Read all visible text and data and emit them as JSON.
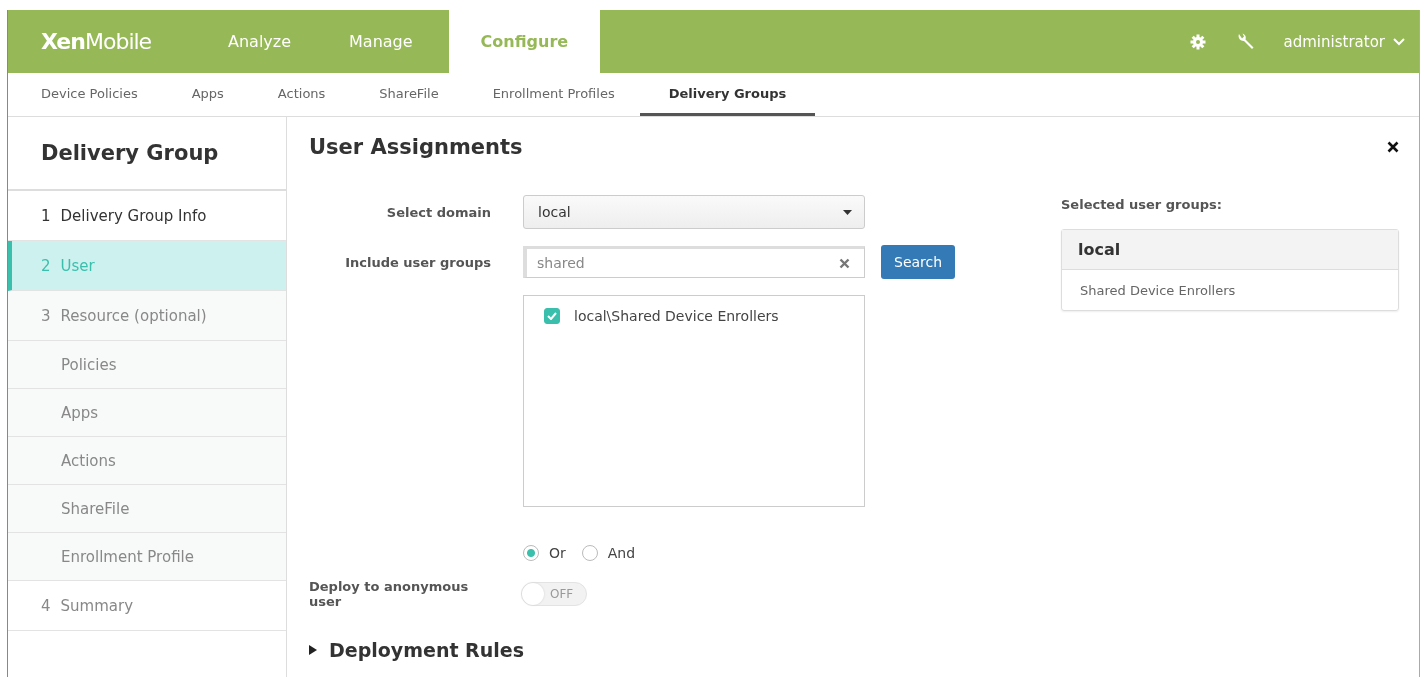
{
  "header": {
    "logo_bold": "Xen",
    "logo_light": "Mobile",
    "tabs": [
      {
        "label": "Analyze",
        "selected": false
      },
      {
        "label": "Manage",
        "selected": false
      },
      {
        "label": "Configure",
        "selected": true
      }
    ],
    "user": "administrator"
  },
  "subnav": [
    {
      "label": "Device Policies",
      "selected": false
    },
    {
      "label": "Apps",
      "selected": false
    },
    {
      "label": "Actions",
      "selected": false
    },
    {
      "label": "ShareFile",
      "selected": false
    },
    {
      "label": "Enrollment Profiles",
      "selected": false
    },
    {
      "label": "Delivery Groups",
      "selected": true
    }
  ],
  "sidebar": {
    "title": "Delivery Group",
    "items": [
      {
        "kind": "step",
        "number": "1",
        "label": "Delivery Group Info",
        "selected": false,
        "done": true
      },
      {
        "kind": "step",
        "number": "2",
        "label": "User",
        "selected": true,
        "done": false
      },
      {
        "kind": "section",
        "number": "3",
        "label": "Resource (optional)",
        "selected": false,
        "done": false
      },
      {
        "kind": "sub",
        "label": "Policies",
        "selected": false,
        "done": false
      },
      {
        "kind": "sub",
        "label": "Apps",
        "selected": false,
        "done": false
      },
      {
        "kind": "sub",
        "label": "Actions",
        "selected": false,
        "done": false
      },
      {
        "kind": "sub",
        "label": "ShareFile",
        "selected": false,
        "done": false
      },
      {
        "kind": "sub",
        "label": "Enrollment Profile",
        "selected": false,
        "done": false
      },
      {
        "kind": "step",
        "number": "4",
        "label": "Summary",
        "selected": false,
        "done": false
      }
    ]
  },
  "main": {
    "title": "User Assignments",
    "domain": {
      "label": "Select domain",
      "value": "local"
    },
    "groups": {
      "label": "Include user groups",
      "value": "shared",
      "button": "Search",
      "results": [
        {
          "label": "local\\Shared Device Enrollers",
          "checked": true
        }
      ]
    },
    "logic": [
      {
        "label": "Or",
        "selected": true
      },
      {
        "label": "And",
        "selected": false
      }
    ],
    "anonymous": {
      "label": "Deploy to anonymous user",
      "on": false,
      "state_text": "OFF"
    },
    "rules": {
      "label": "Deployment Rules",
      "expanded": false
    },
    "selected_panel": {
      "label": "Selected user groups:",
      "groups": [
        {
          "name": "local",
          "members": [
            "Shared Device Enrollers"
          ]
        }
      ]
    }
  }
}
